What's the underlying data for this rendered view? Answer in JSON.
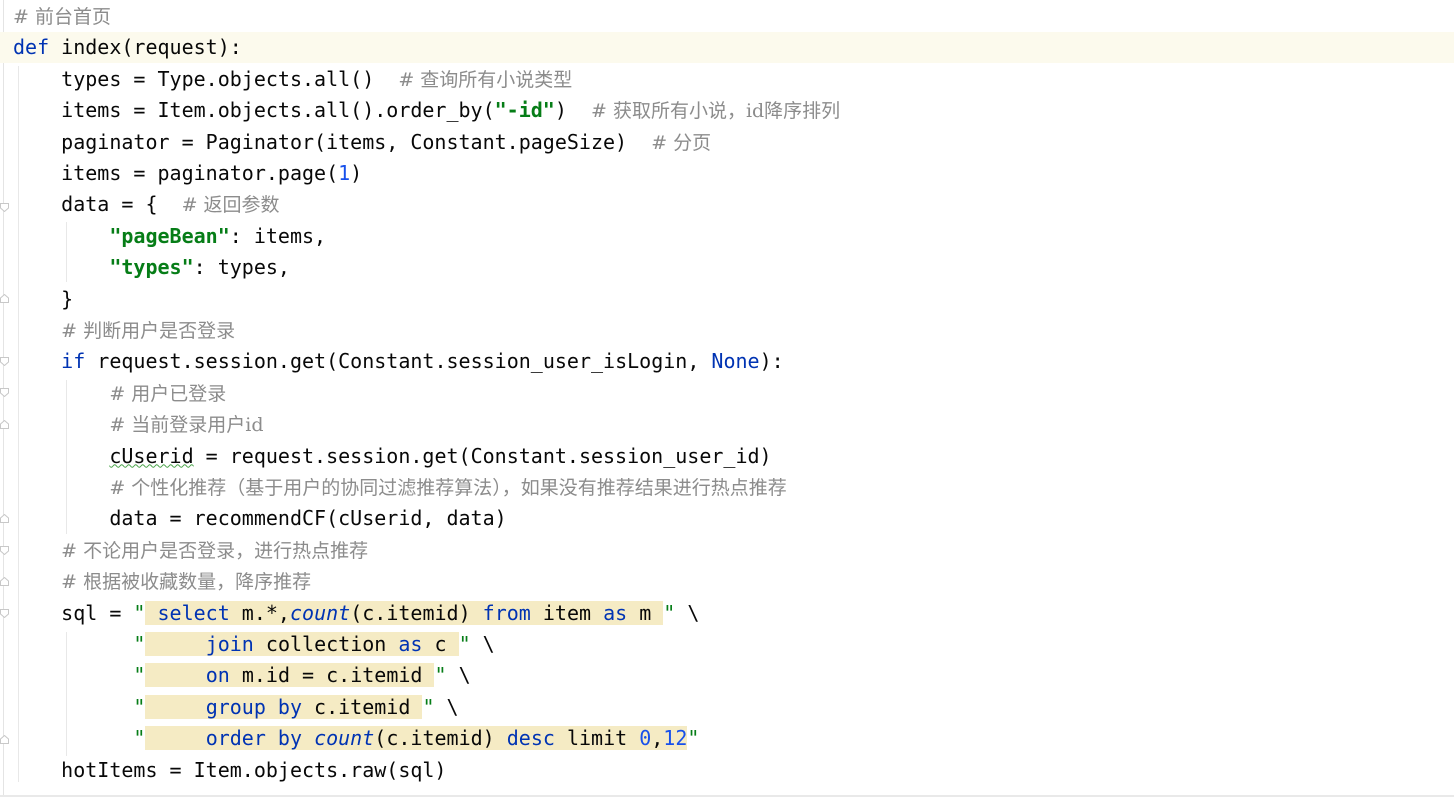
{
  "editor": {
    "lines": [
      {
        "tokens": [
          {
            "t": "# 前台首页",
            "c": "cm"
          }
        ]
      },
      {
        "current": true,
        "tokens": [
          {
            "t": "def",
            "c": "kw"
          },
          {
            "t": " index(request):"
          }
        ]
      },
      {
        "tokens": [
          {
            "t": "    types = Type.objects.all()  "
          },
          {
            "t": "# 查询所有小说类型",
            "c": "cm"
          }
        ]
      },
      {
        "tokens": [
          {
            "t": "    items = Item.objects.all().order_by("
          },
          {
            "t": "\"-id\"",
            "c": "strb"
          },
          {
            "t": ")  "
          },
          {
            "t": "# 获取所有小说，id降序排列",
            "c": "cm"
          }
        ]
      },
      {
        "tokens": [
          {
            "t": "    paginator = Paginator(items, Constant.pageSize)  "
          },
          {
            "t": "# 分页",
            "c": "cm"
          }
        ]
      },
      {
        "tokens": [
          {
            "t": "    items = paginator.page("
          },
          {
            "t": "1",
            "c": "num"
          },
          {
            "t": ")"
          }
        ]
      },
      {
        "tokens": [
          {
            "t": "    data = {  "
          },
          {
            "t": "# 返回参数",
            "c": "cm"
          }
        ]
      },
      {
        "tokens": [
          {
            "t": "        "
          },
          {
            "t": "\"pageBean\"",
            "c": "strb"
          },
          {
            "t": ": items,"
          }
        ]
      },
      {
        "tokens": [
          {
            "t": "        "
          },
          {
            "t": "\"types\"",
            "c": "strb"
          },
          {
            "t": ": types,"
          }
        ]
      },
      {
        "tokens": [
          {
            "t": "    }"
          }
        ]
      },
      {
        "tokens": [
          {
            "t": "    "
          },
          {
            "t": "# 判断用户是否登录",
            "c": "cm"
          }
        ]
      },
      {
        "tokens": [
          {
            "t": "    "
          },
          {
            "t": "if",
            "c": "kw"
          },
          {
            "t": " request.session.get(Constant.session_user_isLogin, "
          },
          {
            "t": "None",
            "c": "kw"
          },
          {
            "t": "):"
          }
        ]
      },
      {
        "tokens": [
          {
            "t": "        "
          },
          {
            "t": "# 用户已登录",
            "c": "cm"
          }
        ]
      },
      {
        "tokens": [
          {
            "t": "        "
          },
          {
            "t": "# 当前登录用户id",
            "c": "cm"
          }
        ]
      },
      {
        "tokens": [
          {
            "t": "        "
          },
          {
            "t": "cUserid",
            "sq": true
          },
          {
            "t": " = request.session.get(Constant.session_user_id)"
          }
        ]
      },
      {
        "tokens": [
          {
            "t": "        "
          },
          {
            "t": "# 个性化推荐（基于用户的协同过滤推荐算法），如果没有推荐结果进行热点推荐",
            "c": "cm"
          }
        ]
      },
      {
        "tokens": [
          {
            "t": "        data = recommendCF(cUserid, data)"
          }
        ]
      },
      {
        "tokens": [
          {
            "t": "    "
          },
          {
            "t": "# 不论用户是否登录，进行热点推荐",
            "c": "cm"
          }
        ]
      },
      {
        "tokens": [
          {
            "t": "    "
          },
          {
            "t": "# 根据被收藏数量，降序推荐",
            "c": "cm"
          }
        ]
      },
      {
        "tokens": [
          {
            "t": "    sql = "
          },
          {
            "t": "\"",
            "c": "str"
          },
          {
            "t": " ",
            "c": "hl"
          },
          {
            "t": "select",
            "c": "kw hl"
          },
          {
            "t": " m.*,",
            "c": "hl"
          },
          {
            "t": "count",
            "c": "fn hl"
          },
          {
            "t": "(c.itemid) ",
            "c": "hl"
          },
          {
            "t": "from",
            "c": "kw hl"
          },
          {
            "t": " item ",
            "c": "hl"
          },
          {
            "t": "as",
            "c": "kw hl"
          },
          {
            "t": " m ",
            "c": "hl"
          },
          {
            "t": "\"",
            "c": "str"
          },
          {
            "t": " \\"
          }
        ]
      },
      {
        "tokens": [
          {
            "t": "          "
          },
          {
            "t": "\"",
            "c": "str"
          },
          {
            "t": "     ",
            "c": "hl"
          },
          {
            "t": "join",
            "c": "kw hl"
          },
          {
            "t": " collection ",
            "c": "hl"
          },
          {
            "t": "as",
            "c": "kw hl"
          },
          {
            "t": " c ",
            "c": "hl"
          },
          {
            "t": "\"",
            "c": "str"
          },
          {
            "t": " \\"
          }
        ]
      },
      {
        "tokens": [
          {
            "t": "          "
          },
          {
            "t": "\"",
            "c": "str"
          },
          {
            "t": "     ",
            "c": "hl"
          },
          {
            "t": "on",
            "c": "kw hl"
          },
          {
            "t": " m.id = c.itemid ",
            "c": "hl"
          },
          {
            "t": "\"",
            "c": "str"
          },
          {
            "t": " \\"
          }
        ]
      },
      {
        "tokens": [
          {
            "t": "          "
          },
          {
            "t": "\"",
            "c": "str"
          },
          {
            "t": "     ",
            "c": "hl"
          },
          {
            "t": "group by",
            "c": "kw hl"
          },
          {
            "t": " c.itemid ",
            "c": "hl"
          },
          {
            "t": "\"",
            "c": "str"
          },
          {
            "t": " \\"
          }
        ]
      },
      {
        "tokens": [
          {
            "t": "          "
          },
          {
            "t": "\"",
            "c": "str"
          },
          {
            "t": "     ",
            "c": "hl"
          },
          {
            "t": "order by",
            "c": "kw hl"
          },
          {
            "t": " ",
            "c": "hl"
          },
          {
            "t": "count",
            "c": "fn hl"
          },
          {
            "t": "(c.itemid) ",
            "c": "hl"
          },
          {
            "t": "desc",
            "c": "kw hl"
          },
          {
            "t": " limit ",
            "c": "hl"
          },
          {
            "t": "0",
            "c": "num hl"
          },
          {
            "t": ",",
            "c": "hl"
          },
          {
            "t": "12",
            "c": "num hl"
          },
          {
            "t": "\"",
            "c": "str"
          }
        ]
      },
      {
        "tokens": [
          {
            "t": "    hotItems = Item.objects.raw(sql)"
          }
        ]
      }
    ]
  }
}
